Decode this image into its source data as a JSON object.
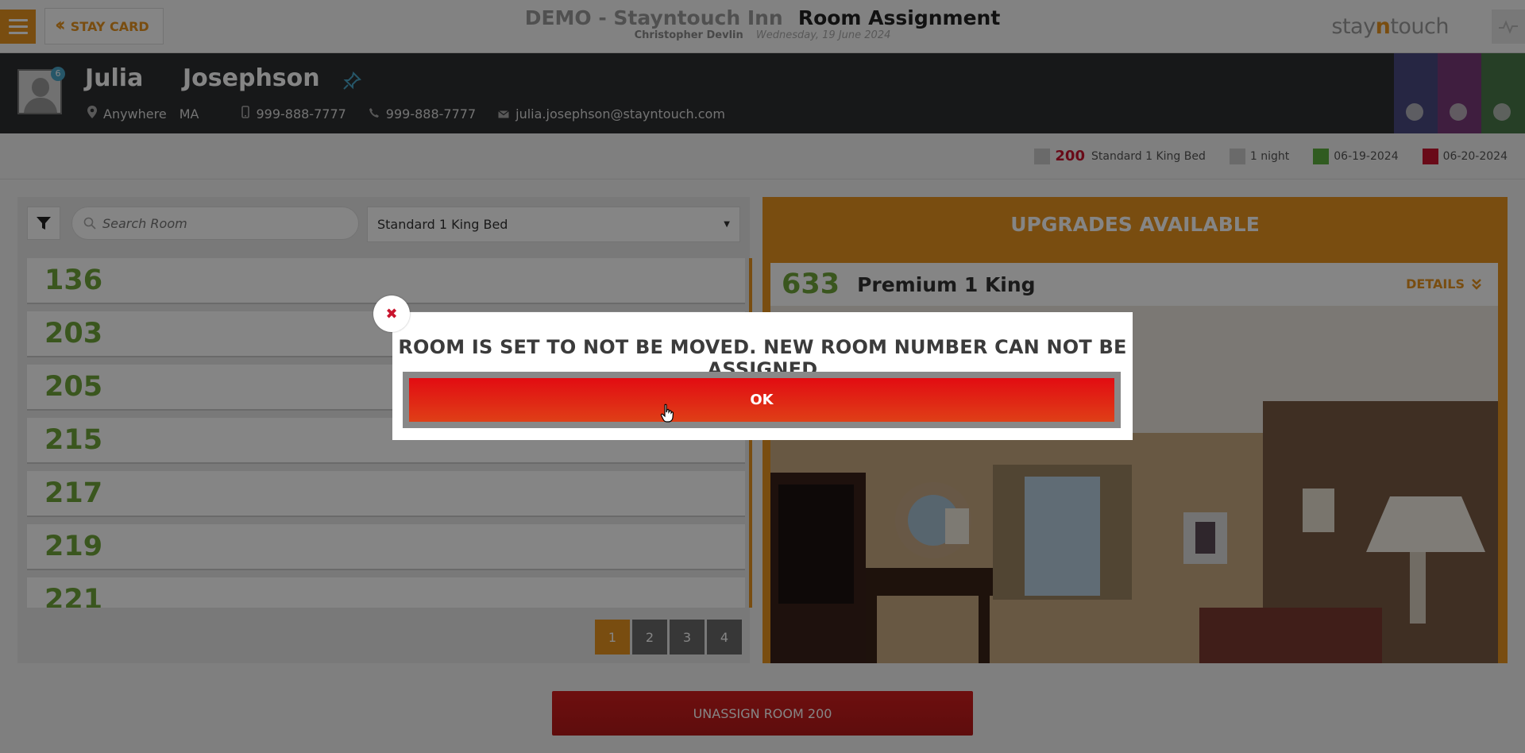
{
  "topbar": {
    "back_label": "STAY CARD",
    "hotel": "DEMO - Stayntouch Inn",
    "page_title": "Room Assignment",
    "user": "Christopher Devlin",
    "date": "Wednesday, 19 June 2024",
    "logo_part1": "stay",
    "logo_part2": "n",
    "logo_part3": "touch"
  },
  "guest": {
    "badge_count": "6",
    "first_name": "Julia",
    "last_name": "Josephson",
    "city": "Anywhere",
    "state": "MA",
    "mobile": "999-888-7777",
    "phone": "999-888-7777",
    "email": "julia.josephson@stayntouch.com",
    "side_tab_colors": [
      "#4a4a80",
      "#7a3a7a",
      "#4a7a4a"
    ]
  },
  "reservation": {
    "room_number": "200",
    "room_type": "Standard 1 King Bed",
    "nights": "1 night",
    "arrival": "06-19-2024",
    "departure": "06-20-2024"
  },
  "left": {
    "search_placeholder": "Search Room",
    "room_type_selected": "Standard 1 King Bed",
    "rooms": [
      "136",
      "203",
      "205",
      "215",
      "217",
      "219",
      "221"
    ],
    "pages": [
      "1",
      "2",
      "3",
      "4"
    ],
    "active_page": "1"
  },
  "upgrades": {
    "title": "UPGRADES AVAILABLE",
    "room_number": "633",
    "room_name": "Premium 1 King",
    "details_label": "DETAILS"
  },
  "footer": {
    "unassign_label": "UNASSIGN ROOM 200"
  },
  "modal": {
    "message": "ROOM IS SET TO NOT BE MOVED. NEW ROOM NUMBER CAN NOT BE ASSIGNED",
    "ok_label": "OK",
    "close_symbol": "✖"
  },
  "colors": {
    "accent": "#e8951f",
    "green": "#6fa63a",
    "red": "#c9152e",
    "dark": "#2d2e31"
  }
}
